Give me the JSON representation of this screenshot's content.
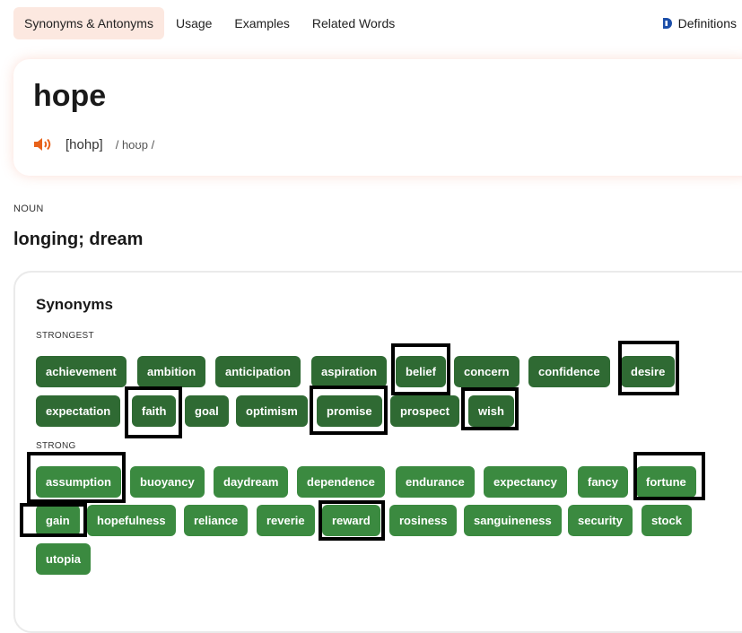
{
  "tabs": [
    {
      "label": "Synonyms & Antonyms",
      "active": true
    },
    {
      "label": "Usage"
    },
    {
      "label": "Examples"
    },
    {
      "label": "Related Words"
    }
  ],
  "definitions_link": {
    "label": "Definitions",
    "icon": "dictionary-logo-icon"
  },
  "entry": {
    "word": "hope",
    "pronunciation": "[hohp]",
    "ipa": "/ hoʊp /",
    "audio_icon": "speaker-icon"
  },
  "sense": {
    "part_of_speech": "NOUN",
    "definition": "longing; dream"
  },
  "synonyms": {
    "title": "Synonyms",
    "groups": [
      {
        "label": "STRONGEST",
        "words": [
          "achievement",
          "ambition",
          "anticipation",
          "aspiration",
          "belief",
          "concern",
          "confidence",
          "desire",
          "expectation",
          "faith",
          "goal",
          "optimism",
          "promise",
          "prospect",
          "wish"
        ]
      },
      {
        "label": "STRONG",
        "words": [
          "assumption",
          "buoyancy",
          "daydream",
          "dependence",
          "endurance",
          "expectancy",
          "fancy",
          "fortune",
          "gain",
          "hopefulness",
          "reliance",
          "reverie",
          "reward",
          "rosiness",
          "sanguineness",
          "security",
          "stock",
          "utopia"
        ]
      }
    ]
  },
  "colors": {
    "tab_active_bg": "#fce8e0",
    "chip_strongest": "#2f6a33",
    "chip_strong": "#3b8a40",
    "speaker": "#e8621a",
    "definitions_logo": "#1b4ea8"
  }
}
